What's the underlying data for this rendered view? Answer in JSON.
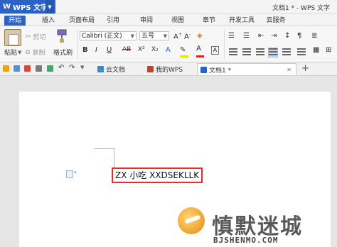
{
  "app": {
    "name": "WPS 文字",
    "logo": "W",
    "document_title": "文档1 * - WPS 文字"
  },
  "ribbon_tabs": [
    "开始",
    "插入",
    "页面布局",
    "引用",
    "审阅",
    "视图",
    "章节",
    "开发工具",
    "云服务"
  ],
  "clipboard": {
    "paste": "粘贴",
    "cut": "剪切",
    "copy": "复制",
    "format_painter": "格式刷"
  },
  "font": {
    "family": "Calibri (正文)",
    "size": "五号"
  },
  "format_buttons": [
    "B",
    "I",
    "U",
    "AB",
    "X²",
    "X₂",
    "A",
    "A"
  ],
  "doc_tabs": [
    {
      "label": "云文档",
      "icon": "cloud-icon",
      "color": "#2b8fd6"
    },
    {
      "label": "我的WPS",
      "icon": "wps-icon",
      "color": "#d23a2a"
    },
    {
      "label": "文档1 *",
      "icon": "doc-icon",
      "color": "#2b63c4"
    }
  ],
  "document": {
    "text": "ZX 小吃 XXDSEKLLK"
  },
  "watermark": {
    "brand": "慎默迷城",
    "url": "BJSHENMO.COM"
  },
  "colors": {
    "accent": "#2b63c4",
    "highlight_box": "#e0312e",
    "font_color": "#d7261c",
    "highlight_color": "#f5e000"
  }
}
